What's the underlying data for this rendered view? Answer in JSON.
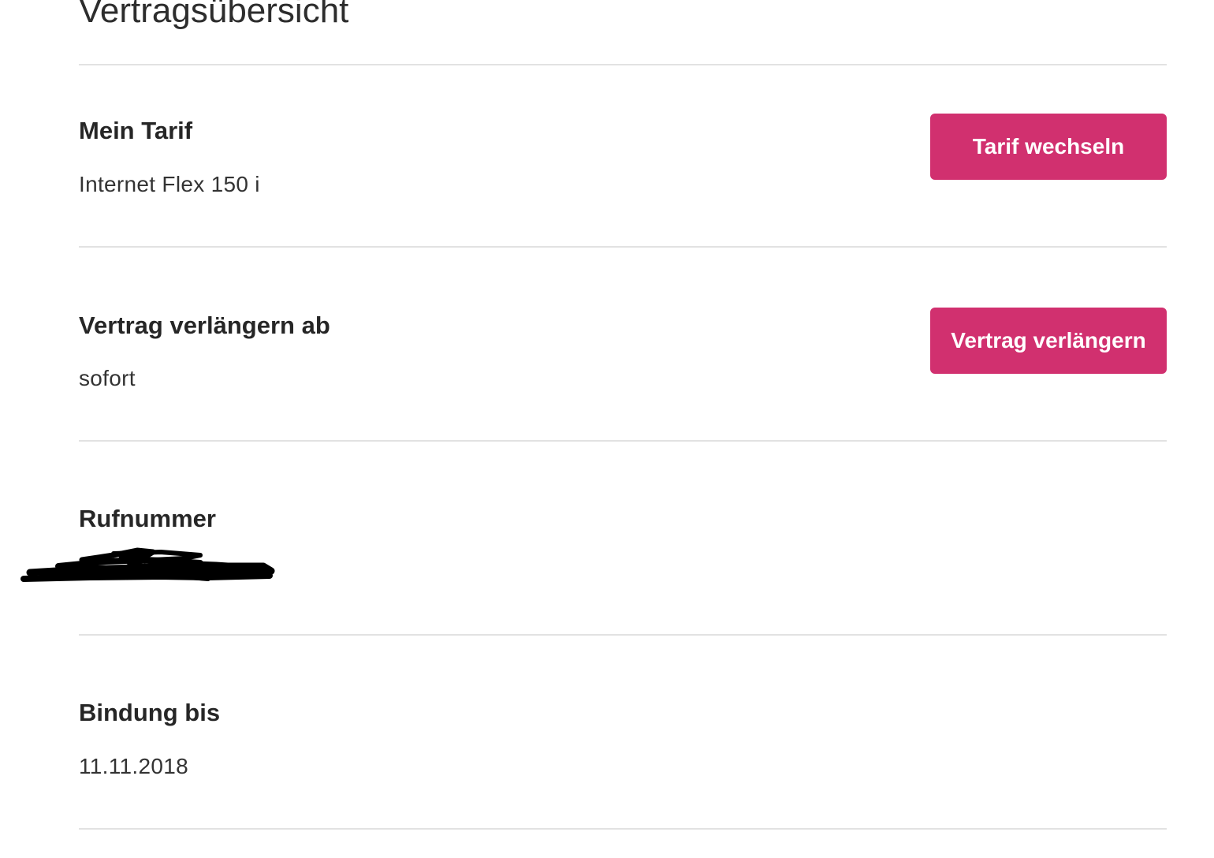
{
  "page": {
    "title": "Vertragsübersicht"
  },
  "colors": {
    "accent": "#d1306f",
    "divider": "#e2e2e2",
    "text": "#262626"
  },
  "sections": [
    {
      "label": "Mein Tarif",
      "value": "Internet Flex 150 i",
      "button_label": "Tarif wechseln"
    },
    {
      "label": "Vertrag verlängern ab",
      "value": "sofort",
      "button_label": "Vertrag verlängern"
    },
    {
      "label": "Rufnummer",
      "value": "",
      "redacted": true
    },
    {
      "label": "Bindung bis",
      "value": "11.11.2018"
    }
  ]
}
